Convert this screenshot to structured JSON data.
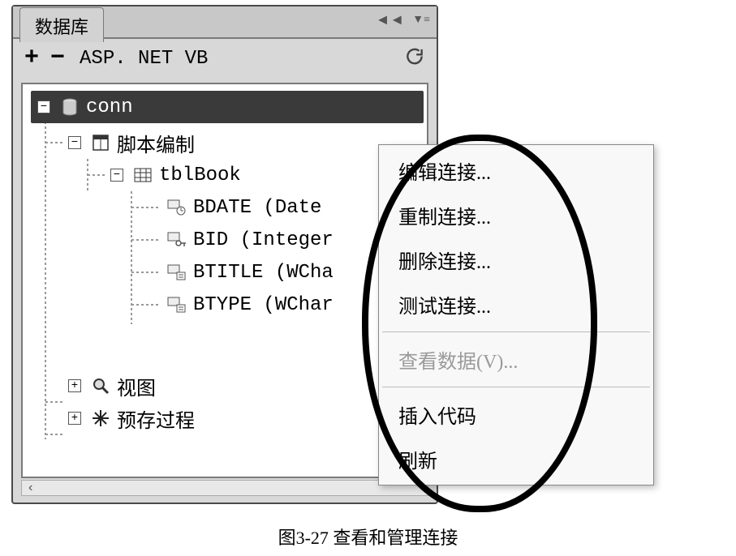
{
  "panel": {
    "title": "数据库",
    "toolbar": {
      "plus": "+",
      "minus": "−",
      "tech": "ASP. NET VB"
    }
  },
  "tree": {
    "conn": "conn",
    "script": "脚本编制",
    "table": "tblBook",
    "cols": {
      "bdate": "BDATE (Date",
      "bid": "BID (Integer",
      "btitle": "BTITLE (WCha",
      "btype": "BTYPE (WChar"
    },
    "views": "视图",
    "procs": "预存过程"
  },
  "menu": {
    "edit": "编辑连接...",
    "recreate": "重制连接...",
    "delete": "删除连接...",
    "test": "测试连接...",
    "viewdata": "查看数据(V)...",
    "insert": "插入代码",
    "refresh": "刷新"
  },
  "caption": "图3-27  查看和管理连接"
}
